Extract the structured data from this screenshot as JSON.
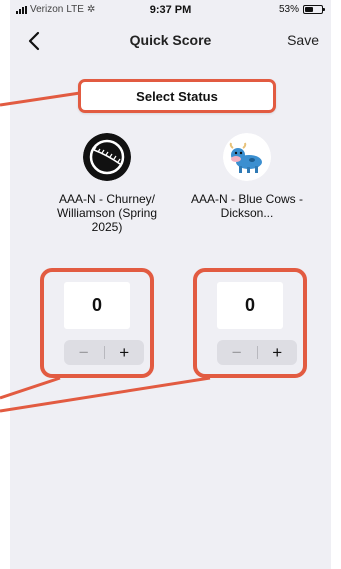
{
  "status_bar": {
    "carrier": "Verizon",
    "network": "LTE",
    "time": "9:37 PM",
    "battery_text": "53%",
    "battery_level": 0.53
  },
  "nav": {
    "title": "Quick Score",
    "save_label": "Save"
  },
  "select_status": {
    "label": "Select Status"
  },
  "teams": {
    "home": {
      "name": "AAA-N - Churney/ Williamson (Spring 2025)",
      "logo_icon": "baseball-icon",
      "score": "0"
    },
    "away": {
      "name": "AAA-N - Blue Cows - Dickson...",
      "logo_icon": "cow-icon",
      "score": "0"
    }
  },
  "stepper": {
    "minus_label": "−",
    "plus_label": "+"
  },
  "colors": {
    "annotation": "#e25b41",
    "background": "#efeff4",
    "stepper": "#dddde3"
  }
}
